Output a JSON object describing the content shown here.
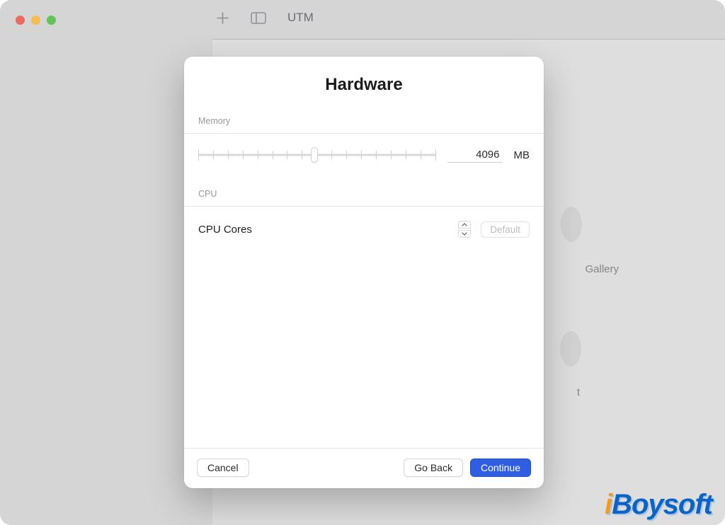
{
  "toolbar": {
    "app_title": "UTM"
  },
  "background": {
    "gallery_label": "Gallery",
    "trailing_letter": "t"
  },
  "modal": {
    "title": "Hardware",
    "memory": {
      "section_label": "Memory",
      "value": "4096",
      "unit": "MB",
      "ticks": 17
    },
    "cpu": {
      "section_label": "CPU",
      "row_label": "CPU Cores",
      "default_button": "Default"
    },
    "footer": {
      "cancel": "Cancel",
      "go_back": "Go Back",
      "continue": "Continue"
    }
  },
  "watermark": {
    "text": "iBoysoft"
  }
}
